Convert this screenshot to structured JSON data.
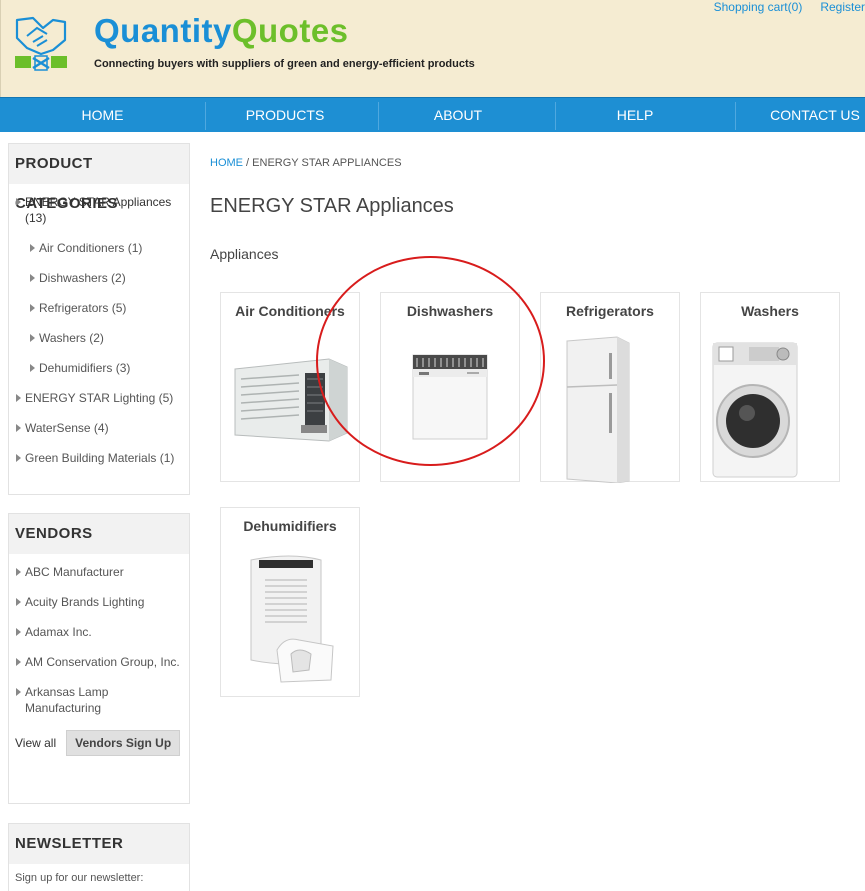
{
  "header": {
    "brand_part1": "Quantity",
    "brand_part2": "Quotes",
    "tagline": "Connecting buyers with suppliers of green and energy-efficient products",
    "cart_link": "Shopping cart(0)",
    "register_link": "Register"
  },
  "nav": {
    "items": [
      {
        "label": "HOME"
      },
      {
        "label": "PRODUCTS"
      },
      {
        "label": "ABOUT"
      },
      {
        "label": "HELP"
      },
      {
        "label": "CONTACT US"
      }
    ]
  },
  "categories": {
    "title": "PRODUCT CATEGORIES",
    "items": [
      {
        "label": "ENERGY STAR Appliances (13)"
      },
      {
        "label": "Air Conditioners (1)"
      },
      {
        "label": "Dishwashers (2)"
      },
      {
        "label": "Refrigerators (5)"
      },
      {
        "label": "Washers (2)"
      },
      {
        "label": "Dehumidifiers (3)"
      },
      {
        "label": "ENERGY STAR Lighting (5)"
      },
      {
        "label": "WaterSense (4)"
      },
      {
        "label": "Green Building Materials (1)"
      }
    ]
  },
  "vendors": {
    "title": "VENDORS",
    "items": [
      {
        "label": "ABC Manufacturer"
      },
      {
        "label": "Acuity Brands Lighting"
      },
      {
        "label": "Adamax Inc."
      },
      {
        "label": "AM Conservation Group, Inc."
      },
      {
        "label": "Arkansas Lamp Manufacturing"
      }
    ],
    "view_all": "View all",
    "signup_button": "Vendors Sign Up"
  },
  "newsletter": {
    "title": "NEWSLETTER",
    "text": "Sign up for our newsletter:"
  },
  "main": {
    "breadcrumb_home": "HOME",
    "breadcrumb_sep": " / ",
    "breadcrumb_current": "ENERGY STAR APPLIANCES",
    "title": "ENERGY STAR Appliances",
    "section": "Appliances",
    "products": [
      {
        "name": "Air Conditioners"
      },
      {
        "name": "Dishwashers"
      },
      {
        "name": "Refrigerators"
      },
      {
        "name": "Washers"
      },
      {
        "name": "Dehumidifiers"
      }
    ]
  },
  "colors": {
    "nav_bg": "#1e8fd3",
    "header_bg": "#f5ecd2",
    "brand_blue": "#1a8fd6",
    "brand_green": "#6cbf2a",
    "highlight_circle": "#d81c1c"
  }
}
